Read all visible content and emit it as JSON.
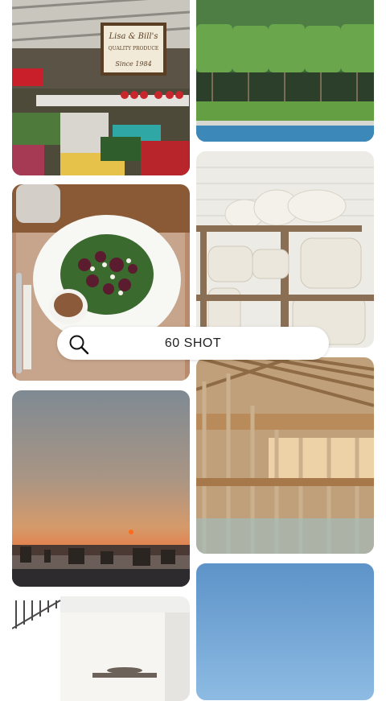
{
  "search": {
    "query": "60 SHOT",
    "icon": "search-icon"
  },
  "tiles": {
    "produce": {
      "sign_line1": "Lisa & Bill's",
      "sign_line2": "QUALITY PRODUCE",
      "sign_line3": "Since 1984"
    }
  }
}
